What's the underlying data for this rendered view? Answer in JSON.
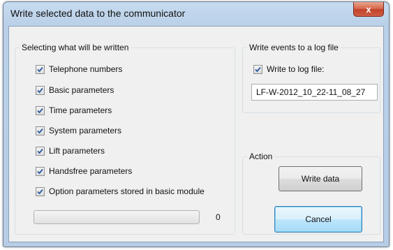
{
  "window": {
    "title": "Write selected data to the communicator",
    "close_glyph": "x"
  },
  "selection_group": {
    "title": "Selecting what will be written",
    "items": [
      {
        "label": "Telephone numbers",
        "checked": true
      },
      {
        "label": "Basic parameters",
        "checked": true
      },
      {
        "label": "Time parameters",
        "checked": true
      },
      {
        "label": "System parameters",
        "checked": true
      },
      {
        "label": "Lift parameters",
        "checked": true
      },
      {
        "label": "Handsfree parameters",
        "checked": true
      },
      {
        "label": "Option parameters stored in basic module",
        "checked": true
      }
    ]
  },
  "progress": {
    "value_text": "0",
    "fraction": 0
  },
  "log_group": {
    "title": "Write events to a log file",
    "checkbox_label": "Write to log file:",
    "checked": true,
    "filename": "LF-W-2012_10_22-11_08_27"
  },
  "action_group": {
    "title": "Action",
    "write_label": "Write data",
    "cancel_label": "Cancel"
  },
  "colors": {
    "titlebar": "#b9d0e8",
    "close_button": "#c2412a",
    "dialog_bg": "#f0f0f0",
    "default_button_border": "#3c7fb1"
  }
}
